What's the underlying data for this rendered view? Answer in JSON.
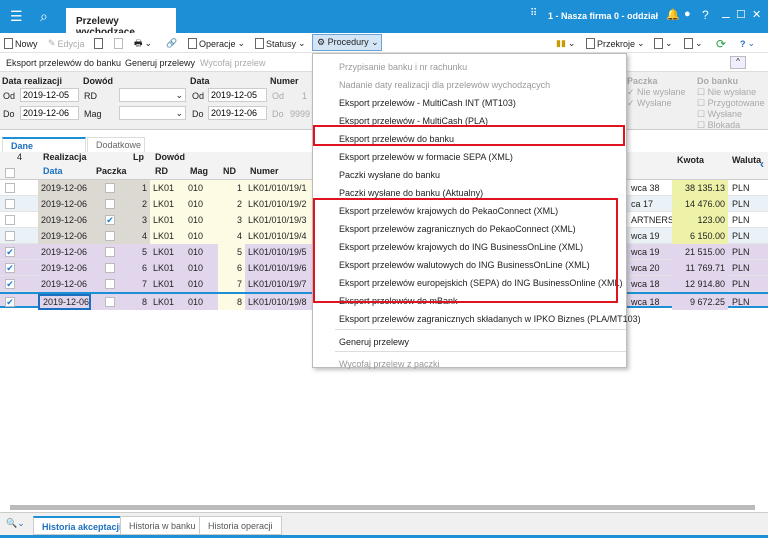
{
  "window": {
    "tab_title": "Przelewy wychodzące",
    "company": "1 - Nasza firma 0 - oddział"
  },
  "toolbar": {
    "new": "Nowy",
    "edit": "Edycja",
    "operations": "Operacje",
    "statuses": "Statusy",
    "procedures": "Procedury",
    "views": "Przekroje"
  },
  "actions": {
    "export": "Eksport przelewów do banku",
    "generate": "Generuj przelewy",
    "withdraw": "Wycofaj przelew"
  },
  "filters": {
    "date_label": "Data realizacji",
    "from": "Od",
    "to": "Do",
    "date_from": "2019-12-05",
    "date_to": "2019-12-06",
    "doc_label": "Dowód",
    "rd": "RD",
    "mag": "Mag",
    "data_label": "Data",
    "data_from": "2019-12-05",
    "data_to": "2019-12-06",
    "number_label": "Numer",
    "number_from": "1",
    "number_to": "9999",
    "package_label": "Paczka",
    "package_opts": [
      "Nie wysłane",
      "Wysłane"
    ],
    "bank_label": "Do banku",
    "bank_opts": [
      "Nie wysłane",
      "Przygotowane",
      "Wysłane",
      "Blokada"
    ]
  },
  "tabs": [
    "Dane podstawowe",
    "Dodatkowe"
  ],
  "grid": {
    "count": "4",
    "h_realizacja": "Realizacja",
    "h_data": "Data",
    "h_paczka": "Paczka",
    "h_lp": "Lp",
    "h_dowod": "Dowód",
    "h_rd": "RD",
    "h_mag": "Mag",
    "h_nd": "ND",
    "h_numer": "Numer",
    "h_kwota": "Kwota",
    "h_waluta": "Waluta",
    "rows": [
      {
        "checked": false,
        "data": "2019-12-06",
        "paczka": false,
        "lp": "1",
        "rd": "LK01",
        "mag": "010",
        "nd": "1",
        "numer": "LK01/010/19/1",
        "kontr": "wca 38",
        "kwota": "38 135.13",
        "waluta": "PLN"
      },
      {
        "checked": false,
        "data": "2019-12-06",
        "paczka": false,
        "lp": "2",
        "rd": "LK01",
        "mag": "010",
        "nd": "2",
        "numer": "LK01/010/19/2",
        "kontr": "ca 17",
        "kwota": "14 476.00",
        "waluta": "PLN"
      },
      {
        "checked": false,
        "data": "2019-12-06",
        "paczka": true,
        "lp": "3",
        "rd": "LK01",
        "mag": "010",
        "nd": "3",
        "numer": "LK01/010/19/3",
        "kontr": "ARTNERS SI",
        "kwota": "123.00",
        "waluta": "PLN"
      },
      {
        "checked": false,
        "data": "2019-12-06",
        "paczka": false,
        "lp": "4",
        "rd": "LK01",
        "mag": "010",
        "nd": "4",
        "numer": "LK01/010/19/4",
        "kontr": "wca 19",
        "kwota": "6 150.00",
        "waluta": "PLN"
      },
      {
        "checked": true,
        "data": "2019-12-06",
        "paczka": false,
        "lp": "5",
        "rd": "LK01",
        "mag": "010",
        "nd": "5",
        "numer": "LK01/010/19/5",
        "kontr": "wca 19",
        "kwota": "21 515.00",
        "waluta": "PLN"
      },
      {
        "checked": true,
        "data": "2019-12-06",
        "paczka": false,
        "lp": "6",
        "rd": "LK01",
        "mag": "010",
        "nd": "6",
        "numer": "LK01/010/19/6",
        "kontr": "wca 20",
        "kwota": "11 769.71",
        "waluta": "PLN"
      },
      {
        "checked": true,
        "data": "2019-12-06",
        "paczka": false,
        "lp": "7",
        "rd": "LK01",
        "mag": "010",
        "nd": "7",
        "numer": "LK01/010/19/7",
        "kontr": "wca 18",
        "kwota": "12 914.80",
        "waluta": "PLN"
      },
      {
        "checked": true,
        "data": "2019-12-06",
        "paczka": false,
        "lp": "8",
        "rd": "LK01",
        "mag": "010",
        "nd": "8",
        "numer": "LK01/010/19/8",
        "kontr": "wca 18",
        "kwota": "9 672.25",
        "waluta": "PLN"
      }
    ]
  },
  "menu": [
    {
      "label": "Przypisanie banku i nr rachunku",
      "disabled": true
    },
    {
      "label": "Nadanie daty realizacji dla przelewów wychodzących",
      "disabled": true
    },
    {
      "label": "Eksport przelewów - MultiCash INT (MT103)"
    },
    {
      "label": "Eksport przelewów - MultiCash (PLA)"
    },
    {
      "label": "Eksport przelewów do banku"
    },
    {
      "label": "Eksport przelewów w formacie SEPA (XML)"
    },
    {
      "label": "Paczki wysłane do banku"
    },
    {
      "label": "Paczki wysłane do banku (Aktualny)"
    },
    {
      "label": "Eksport przelewów krajowych do PekaoConnect (XML)"
    },
    {
      "label": "Eksport przelewów zagranicznych do PekaoConnect (XML)"
    },
    {
      "label": "Eksport przelewów krajowych do ING BusinessOnLine (XML)"
    },
    {
      "label": "Eksport przelewów walutowych do ING BusinessOnLine (XML)"
    },
    {
      "label": "Eksport przelewów europejskich (SEPA) do ING BusinessOnline (XML)"
    },
    {
      "label": "Eksport przelewów do mBank"
    },
    {
      "label": "Eksport przelewów zagranicznych składanych w IPKO Biznes (PLA/MT103)"
    },
    {
      "label": "Generuj przelewy"
    },
    {
      "label": "Wycofaj przelew z paczki",
      "disabled": true
    }
  ],
  "bottom_tabs": [
    "Historia akceptacji",
    "Historia w banku",
    "Historia operacji"
  ],
  "colors": {
    "titlebar": "#1d8fd6",
    "highlight": "#e0141e",
    "selected_row": "#e2d6ec",
    "amount_bg": "#eef2a8"
  }
}
